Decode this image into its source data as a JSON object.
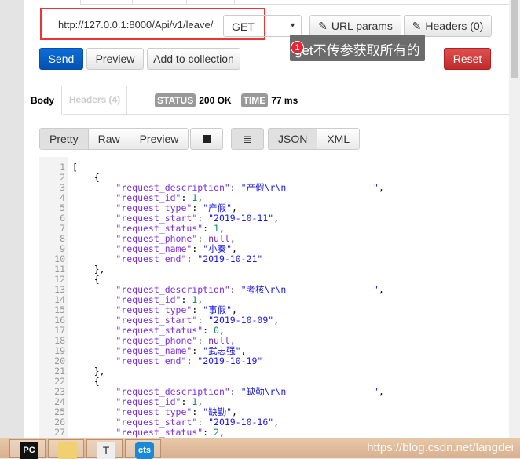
{
  "request": {
    "url": "http://127.0.0.1:8000/Api/v1/leave/",
    "method": "GET",
    "url_params": "URL params",
    "headers": "Headers (0)",
    "send": "Send",
    "preview": "Preview",
    "add_collection": "Add to collection",
    "reset": "Reset"
  },
  "annotation": {
    "number": "1",
    "text": "get不传参获取所有的"
  },
  "response": {
    "tab_body": "Body",
    "tab_headers": "Headers (4)",
    "status_label": "STATUS",
    "status": "200 OK",
    "time_label": "TIME",
    "time": "77 ms"
  },
  "view": {
    "pretty": "Pretty",
    "raw": "Raw",
    "preview": "Preview",
    "json": "JSON",
    "xml": "XML"
  },
  "code_lines": [
    "[",
    "    {",
    "        \"request_description\": \"产假\\r\\n                \",",
    "        \"request_id\": 1,",
    "        \"request_type\": \"产假\",",
    "        \"request_start\": \"2019-10-11\",",
    "        \"request_status\": 1,",
    "        \"request_phone\": null,",
    "        \"request_name\": \"小秦\",",
    "        \"request_end\": \"2019-10-21\"",
    "    },",
    "    {",
    "        \"request_description\": \"考核\\r\\n                \",",
    "        \"request_id\": 1,",
    "        \"request_type\": \"事假\",",
    "        \"request_start\": \"2019-10-09\",",
    "        \"request_status\": 0,",
    "        \"request_phone\": null,",
    "        \"request_name\": \"武志强\",",
    "        \"request_end\": \"2019-10-19\"",
    "    },",
    "    {",
    "        \"request_description\": \"缺勤\\r\\n                \",",
    "        \"request_id\": 1,",
    "        \"request_type\": \"缺勤\",",
    "        \"request_start\": \"2019-10-16\",",
    "        \"request_status\": 2,"
  ],
  "taskbar": {
    "apps": [
      "pycharm",
      "file-explorer",
      "typora",
      "cts"
    ],
    "pc_label": "PC",
    "cts_label": "cts",
    "t_label": "T",
    "watermark": "https://blog.csdn.net/langdei"
  }
}
